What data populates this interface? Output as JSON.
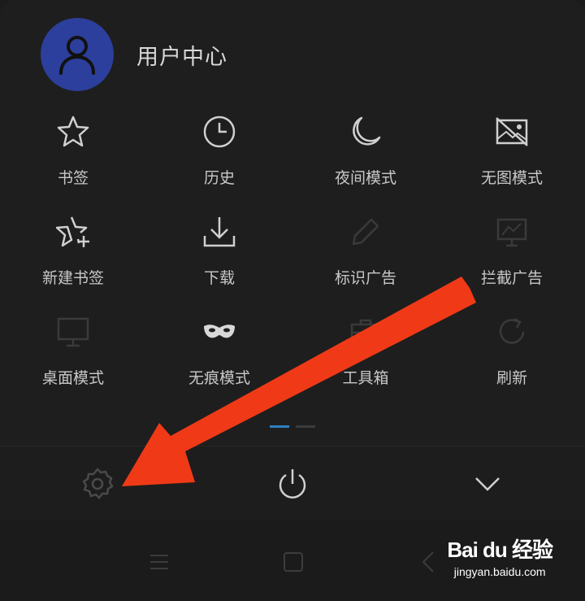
{
  "user": {
    "label": "用户中心"
  },
  "menu": [
    {
      "label": "书签",
      "icon": "star-icon",
      "enabled": true
    },
    {
      "label": "历史",
      "icon": "clock-icon",
      "enabled": true
    },
    {
      "label": "夜间模式",
      "icon": "moon-icon",
      "enabled": true
    },
    {
      "label": "无图模式",
      "icon": "no-image-icon",
      "enabled": true
    },
    {
      "label": "新建书签",
      "icon": "star-plus-icon",
      "enabled": true
    },
    {
      "label": "下载",
      "icon": "download-icon",
      "enabled": true
    },
    {
      "label": "标识广告",
      "icon": "pencil-icon",
      "enabled": false
    },
    {
      "label": "拦截广告",
      "icon": "blocked-monitor-icon",
      "enabled": false
    },
    {
      "label": "桌面模式",
      "icon": "monitor-icon",
      "enabled": false
    },
    {
      "label": "无痕模式",
      "icon": "mask-icon",
      "enabled": true
    },
    {
      "label": "工具箱",
      "icon": "toolbox-icon",
      "enabled": false
    },
    {
      "label": "刷新",
      "icon": "refresh-icon",
      "enabled": false
    }
  ],
  "pager": {
    "current": 1,
    "total": 2
  },
  "bottom": {
    "settings": "gear-icon",
    "exit": "power-icon",
    "collapse": "chevron-down-icon"
  },
  "watermark": {
    "logo": "Bai du 经验",
    "url": "jingyan.baidu.com"
  },
  "colors": {
    "accent": "#2f7fbf",
    "avatar": "#2c3f9c",
    "arrow": "#f03a17"
  }
}
